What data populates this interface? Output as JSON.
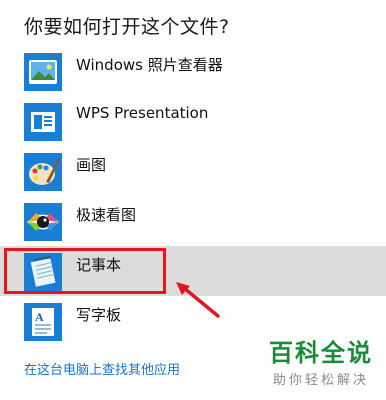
{
  "dialog": {
    "title": "你要如何打开这个文件?"
  },
  "apps": [
    {
      "label": "Windows 照片查看器",
      "icon": "photo-viewer-icon",
      "selected": false
    },
    {
      "label": "WPS Presentation",
      "icon": "wps-presentation-icon",
      "selected": false
    },
    {
      "label": "画图",
      "icon": "paint-palette-icon",
      "selected": false
    },
    {
      "label": "极速看图",
      "icon": "eye-image-icon",
      "selected": false
    },
    {
      "label": "记事本",
      "icon": "notepad-icon",
      "selected": true
    },
    {
      "label": "写字板",
      "icon": "wordpad-icon",
      "selected": false
    }
  ],
  "more_apps_link": "在这台电脑上查找其他应用",
  "watermark": {
    "main": "百科全说",
    "sub": "助你轻松解决"
  },
  "colors": {
    "icon_blue": "#1a7fd4",
    "highlight_red": "#e4161b",
    "link_blue": "#1a73c9",
    "watermark_green": "#1b8a3a"
  }
}
